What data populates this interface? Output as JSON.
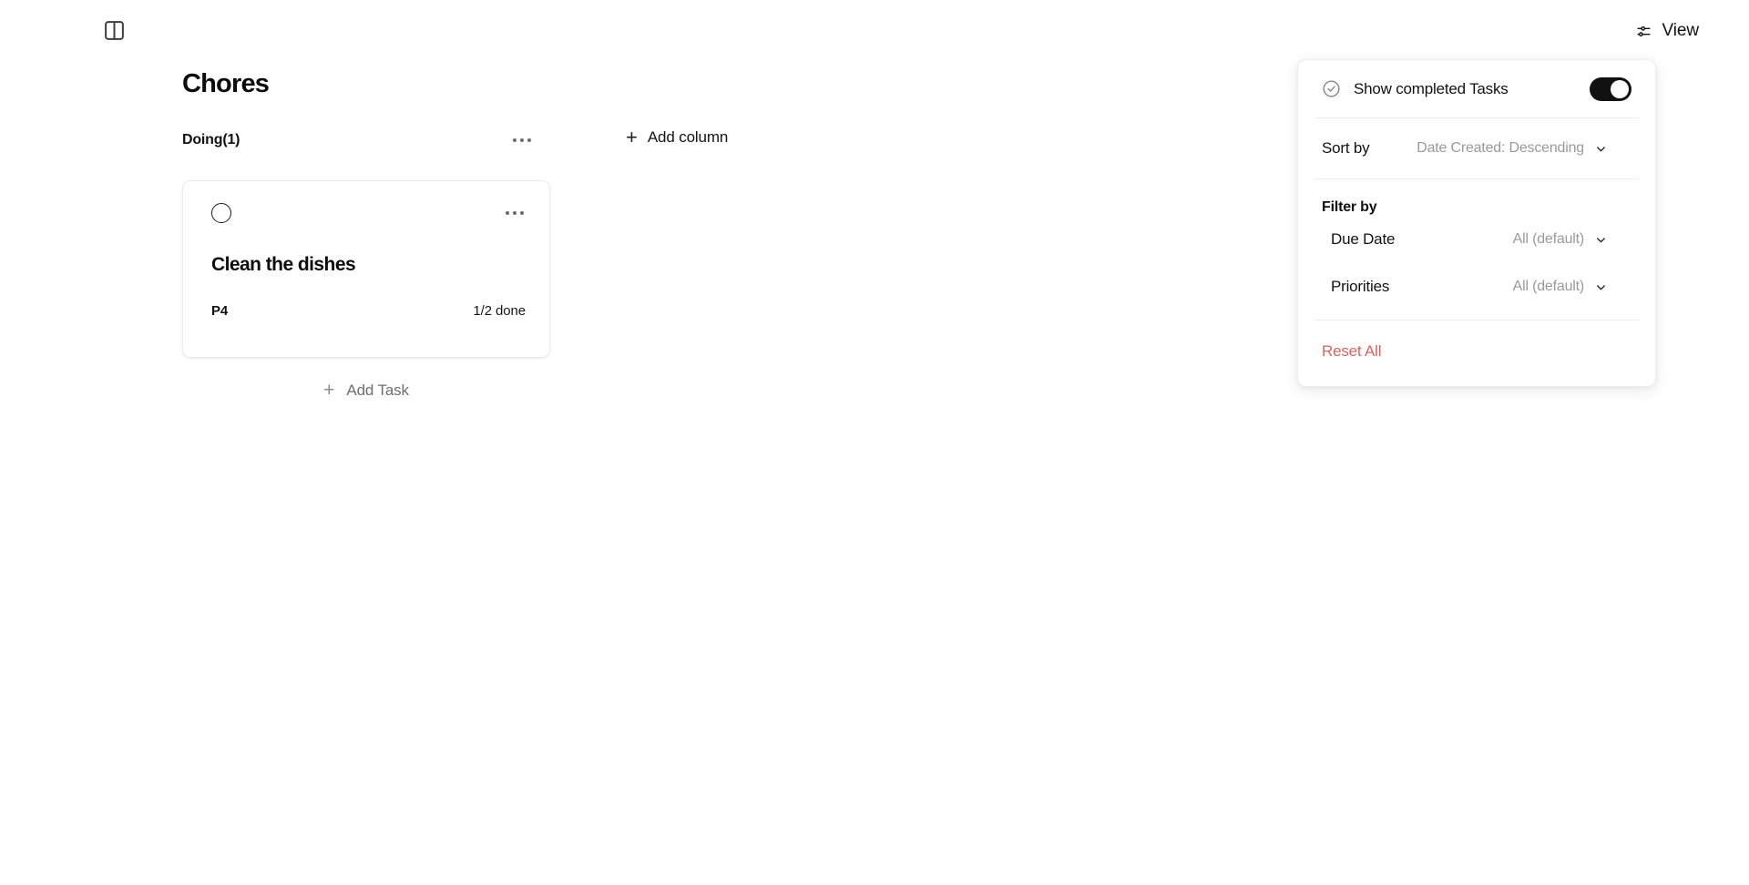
{
  "topbar": {
    "sidebar_toggle_icon": "panel-left-icon",
    "view_button": {
      "label": "View",
      "icon": "sliders-horizontal-icon"
    }
  },
  "board": {
    "title": "Chores",
    "add_column_label": "Add column",
    "add_column_icon": "plus-icon",
    "columns": [
      {
        "name": "Doing(1)",
        "menu_icon": "ellipsis-icon",
        "add_task_label": "Add Task",
        "add_task_icon": "plus-icon",
        "tasks": [
          {
            "checkbox_icon": "circle-unchecked-icon",
            "menu_icon": "ellipsis-icon",
            "title": "Clean the dishes",
            "priority": "P4",
            "progress": "1/2 done"
          }
        ]
      }
    ]
  },
  "view_panel": {
    "show_completed": {
      "icon": "check-circle-icon",
      "label": "Show completed Tasks",
      "toggle_state": "on"
    },
    "sort": {
      "label": "Sort by",
      "value": "Date Created: Descending",
      "chevron_icon": "chevron-down-icon"
    },
    "filter": {
      "heading": "Filter by",
      "rows": [
        {
          "name": "Due Date",
          "value": "All (default)",
          "chevron_icon": "chevron-down-icon"
        },
        {
          "name": "Priorities",
          "value": "All (default)",
          "chevron_icon": "chevron-down-icon"
        }
      ]
    },
    "reset_label": "Reset All"
  },
  "colors": {
    "background": "#ffffff",
    "text": "#111111",
    "muted_text": "#9a9a9a",
    "toggle_on": "#111111",
    "reset_red": "#d66560",
    "card_border": "#ececec",
    "divider": "#ededed"
  }
}
